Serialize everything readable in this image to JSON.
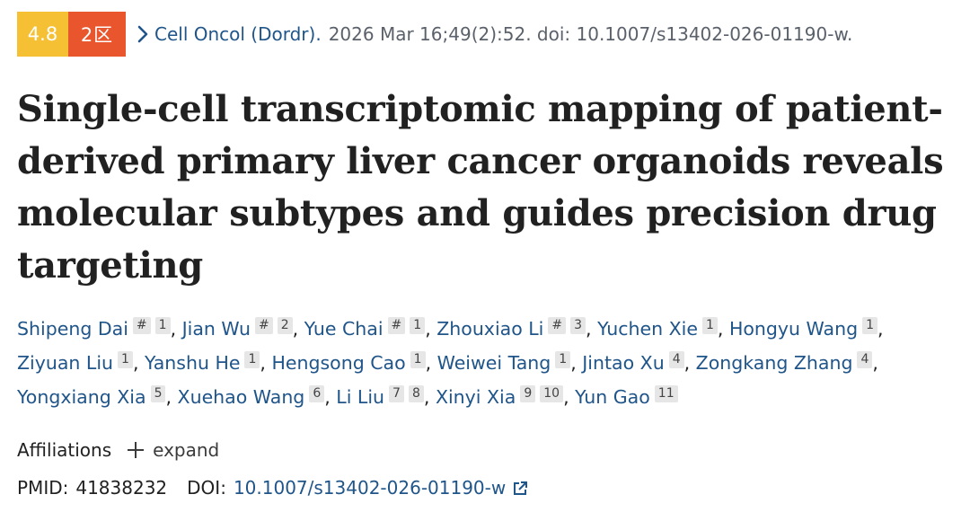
{
  "citation": {
    "impact_factor": "4.8",
    "zone": "2区",
    "journal": "Cell Oncol (Dordr).",
    "details": "2026 Mar 16;49(2):52. doi: 10.1007/s13402-026-01190-w.",
    "colors": {
      "impact_badge": "#f5c033",
      "zone_badge": "#e9552d",
      "link": "#20558a"
    }
  },
  "title_lines": [
    "Single-cell transcriptomic mapping of patient-",
    "derived primary liver cancer organoids reveals",
    "molecular subtypes and guides precision drug",
    "targeting"
  ],
  "authors": [
    {
      "name": "Shipeng Dai",
      "marks": [
        "#",
        "1"
      ]
    },
    {
      "name": "Jian Wu",
      "marks": [
        "#",
        "2"
      ]
    },
    {
      "name": "Yue Chai",
      "marks": [
        "#",
        "1"
      ]
    },
    {
      "name": "Zhouxiao Li",
      "marks": [
        "#",
        "3"
      ]
    },
    {
      "name": "Yuchen Xie",
      "marks": [
        "1"
      ]
    },
    {
      "name": "Hongyu Wang",
      "marks": [
        "1"
      ]
    },
    {
      "name": "Ziyuan Liu",
      "marks": [
        "1"
      ]
    },
    {
      "name": "Yanshu He",
      "marks": [
        "1"
      ]
    },
    {
      "name": "Hengsong Cao",
      "marks": [
        "1"
      ]
    },
    {
      "name": "Weiwei Tang",
      "marks": [
        "1"
      ]
    },
    {
      "name": "Jintao Xu",
      "marks": [
        "4"
      ]
    },
    {
      "name": "Zongkang Zhang",
      "marks": [
        "4"
      ]
    },
    {
      "name": "Yongxiang Xia",
      "marks": [
        "5"
      ]
    },
    {
      "name": "Xuehao Wang",
      "marks": [
        "6"
      ]
    },
    {
      "name": "Li Liu",
      "marks": [
        "7",
        "8"
      ]
    },
    {
      "name": "Xinyi Xia",
      "marks": [
        "9",
        "10"
      ]
    },
    {
      "name": "Yun Gao",
      "marks": [
        "11"
      ]
    }
  ],
  "affiliations": {
    "label": "Affiliations",
    "expand_label": "expand"
  },
  "ids": {
    "pmid_label": "PMID:",
    "pmid": "41838232",
    "doi_label": "DOI:",
    "doi": "10.1007/s13402-026-01190-w"
  },
  "icons": {
    "chevron": "chevron-right-icon",
    "expand": "plus-icon",
    "external": "external-link-icon"
  }
}
